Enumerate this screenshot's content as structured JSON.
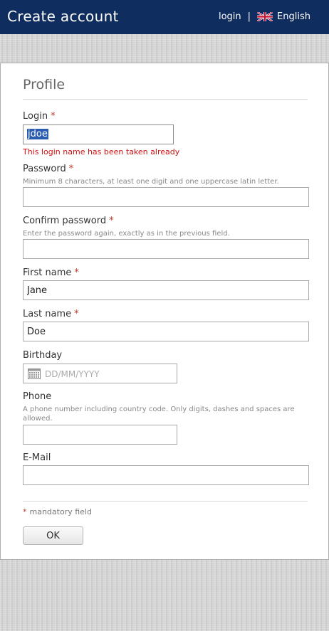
{
  "header": {
    "title": "Create account",
    "login_link": "login",
    "separator": "|",
    "language": "English",
    "language_flag_icon": "uk-flag-icon",
    "bg_color": "#0f2d5e"
  },
  "form": {
    "section_title": "Profile",
    "required_marker": "*",
    "login": {
      "label": "Login",
      "value": "jdoe",
      "error": "This login name has been taken already"
    },
    "password": {
      "label": "Password",
      "hint": "Minimum 8 characters, at least one digit and one uppercase latin letter.",
      "value": ""
    },
    "confirm_password": {
      "label": "Confirm password",
      "hint": "Enter the password again, exactly as in the previous field.",
      "value": ""
    },
    "first_name": {
      "label": "First name",
      "value": "Jane"
    },
    "last_name": {
      "label": "Last name",
      "value": "Doe"
    },
    "birthday": {
      "label": "Birthday",
      "placeholder": "DD/MM/YYYY",
      "value": ""
    },
    "phone": {
      "label": "Phone",
      "hint": "A phone number including country code. Only digits, dashes and spaces are allowed.",
      "value": ""
    },
    "email": {
      "label": "E-Mail",
      "value": ""
    },
    "mandatory_note": "mandatory field",
    "submit_label": "OK",
    "error_color": "#d01010"
  }
}
